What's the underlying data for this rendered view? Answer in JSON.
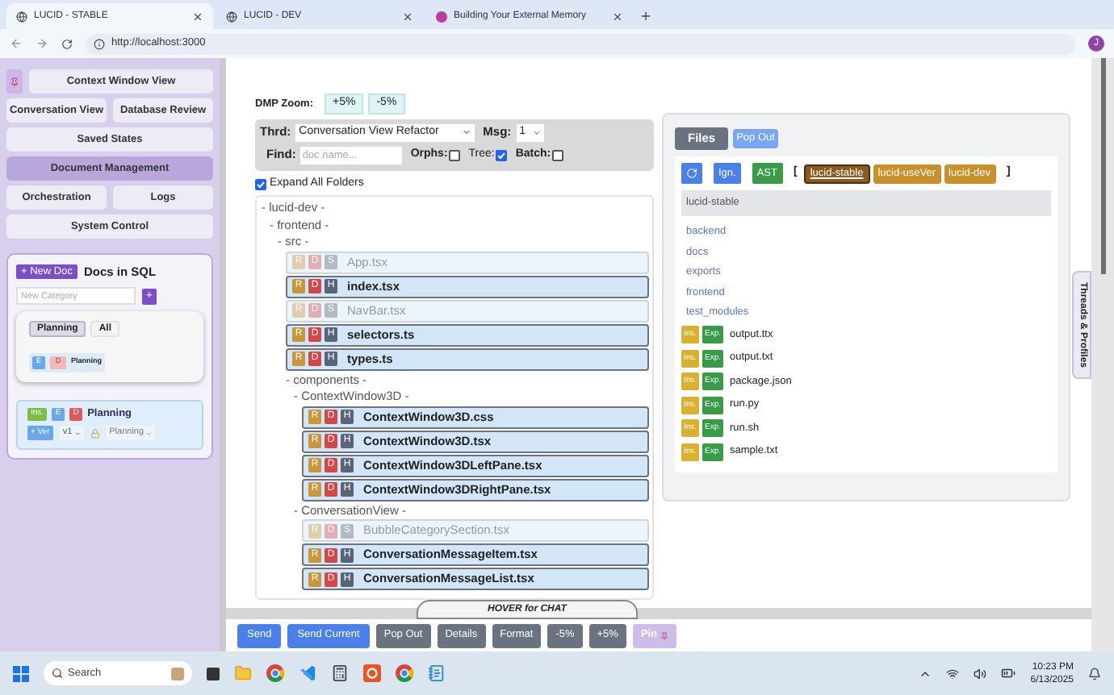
{
  "browser": {
    "tabs": [
      {
        "title": "LUCID - STABLE",
        "selected": true,
        "kind": "globe"
      },
      {
        "title": "LUCID - DEV",
        "selected": false,
        "kind": "globe"
      },
      {
        "title": "Building Your External Memory",
        "selected": false,
        "kind": "dot"
      }
    ],
    "url": "http://localhost:3000",
    "avatar": "J"
  },
  "sidebar": {
    "nav_rows": [
      [
        {
          "label": "Context Window View",
          "selected": false
        }
      ],
      [
        {
          "label": "Conversation View",
          "selected": false
        },
        {
          "label": "Database Review",
          "selected": false
        }
      ],
      [
        {
          "label": "Saved States",
          "selected": false
        }
      ],
      [
        {
          "label": "Document Management",
          "selected": true
        }
      ],
      [
        {
          "label": "Orchestration",
          "selected": false
        },
        {
          "label": "Logs",
          "selected": false
        }
      ],
      [
        {
          "label": "System Control",
          "selected": false
        }
      ]
    ],
    "docs": {
      "new_doc": "+ New Doc",
      "title": "Docs in SQL",
      "category_placeholder": "New Category",
      "add": "+",
      "filters": [
        {
          "label": "Planning",
          "selected": true
        },
        {
          "label": "All",
          "selected": false
        }
      ],
      "chip": {
        "edit": "E",
        "delete": "D",
        "label": "Planning"
      },
      "doc": {
        "ins": "Ins.",
        "edit": "E",
        "delete": "D",
        "title": "Planning",
        "add_version": "+ Ver",
        "version": "v1",
        "category": "Planning"
      }
    }
  },
  "main": {
    "zoom": {
      "label": "DMP Zoom:",
      "buttons": [
        "+5%",
        "-5%"
      ]
    },
    "controls": {
      "thread_label": "Thrd:",
      "thread": "Conversation View Refactor",
      "msg_label": "Msg:",
      "msg": "1",
      "find_label": "Find:",
      "find_placeholder": "doc name...",
      "checks": [
        {
          "label": "Orphs:",
          "checked": false
        },
        {
          "label": "Tree:",
          "checked": true
        },
        {
          "label": "Batch:",
          "checked": false
        }
      ]
    },
    "expand": {
      "label": "Expand All Folders",
      "checked": true
    },
    "tree": [
      {
        "kind": "folder",
        "label": "- lucid-dev -",
        "children": [
          {
            "kind": "folder",
            "label": "- frontend -",
            "children": [
              {
                "kind": "folder",
                "label": "- src -",
                "children": [
                  {
                    "kind": "file",
                    "name": "App.tsx",
                    "badges": [
                      "R",
                      "D",
                      "S"
                    ],
                    "active": false
                  },
                  {
                    "kind": "file",
                    "name": "index.tsx",
                    "badges": [
                      "R",
                      "D",
                      "H"
                    ],
                    "active": true
                  },
                  {
                    "kind": "file",
                    "name": "NavBar.tsx",
                    "badges": [
                      "R",
                      "D",
                      "S"
                    ],
                    "active": false
                  },
                  {
                    "kind": "file",
                    "name": "selectors.ts",
                    "badges": [
                      "R",
                      "D",
                      "H"
                    ],
                    "active": true
                  },
                  {
                    "kind": "file",
                    "name": "types.ts",
                    "badges": [
                      "R",
                      "D",
                      "H"
                    ],
                    "active": true
                  },
                  {
                    "kind": "folder",
                    "label": "- components -",
                    "children": [
                      {
                        "kind": "folder",
                        "label": "- ContextWindow3D -",
                        "children": [
                          {
                            "kind": "file",
                            "name": "ContextWindow3D.css",
                            "badges": [
                              "R",
                              "D",
                              "H"
                            ],
                            "active": true
                          },
                          {
                            "kind": "file",
                            "name": "ContextWindow3D.tsx",
                            "badges": [
                              "R",
                              "D",
                              "H"
                            ],
                            "active": true
                          },
                          {
                            "kind": "file",
                            "name": "ContextWindow3DLeftPane.tsx",
                            "badges": [
                              "R",
                              "D",
                              "H"
                            ],
                            "active": true
                          },
                          {
                            "kind": "file",
                            "name": "ContextWindow3DRightPane.tsx",
                            "badges": [
                              "R",
                              "D",
                              "H"
                            ],
                            "active": true
                          }
                        ]
                      },
                      {
                        "kind": "folder",
                        "label": "- ConversationView -",
                        "children": [
                          {
                            "kind": "file",
                            "name": "BubbleCategorySection.tsx",
                            "badges": [
                              "R",
                              "D",
                              "S"
                            ],
                            "active": false
                          },
                          {
                            "kind": "file",
                            "name": "ConversationMessageItem.tsx",
                            "badges": [
                              "R",
                              "D",
                              "H"
                            ],
                            "active": true
                          },
                          {
                            "kind": "file",
                            "name": "ConversationMessageList.tsx",
                            "badges": [
                              "R",
                              "D",
                              "H"
                            ],
                            "active": true
                          }
                        ]
                      }
                    ]
                  }
                ]
              }
            ]
          }
        ]
      }
    ]
  },
  "files_panel": {
    "tab": "Files",
    "pop_out": "Pop Out",
    "ignore": "Ign.",
    "ast": "AST",
    "open_bracket": "[",
    "close_bracket": "]",
    "repos": [
      {
        "label": "lucid-stable",
        "selected": true
      },
      {
        "label": "lucid-useVer",
        "selected": false
      },
      {
        "label": "lucid-dev",
        "selected": false
      }
    ],
    "path": "lucid-stable",
    "folders": [
      "backend",
      "docs",
      "exports",
      "frontend",
      "test_modules"
    ],
    "files": [
      {
        "name": "output.ttx",
        "import": "Ins.",
        "export": "Exp."
      },
      {
        "name": "output.txt",
        "import": "Ins.",
        "export": "Exp."
      },
      {
        "name": "package.json",
        "import": "Ins.",
        "export": "Exp."
      },
      {
        "name": "run.py",
        "import": "Ins.",
        "export": "Exp."
      },
      {
        "name": "run.sh",
        "import": "Ins.",
        "export": "Exp."
      },
      {
        "name": "sample.txt",
        "import": "Ins.",
        "export": "Exp."
      }
    ]
  },
  "side_tab": "Threads & Profiles",
  "chat_handle": "HOVER for CHAT",
  "actions": [
    {
      "label": "Send",
      "kind": "primary"
    },
    {
      "label": "Send Current",
      "kind": "primary"
    },
    {
      "label": "Pop Out",
      "kind": "secondary"
    },
    {
      "label": "Details",
      "kind": "secondary"
    },
    {
      "label": "Format",
      "kind": "secondary"
    },
    {
      "label": "-5%",
      "kind": "secondary"
    },
    {
      "label": "+5%",
      "kind": "secondary"
    },
    {
      "label": "Pin",
      "kind": "pin"
    }
  ],
  "taskbar": {
    "search_placeholder": "Search",
    "time": "10:23 PM",
    "date": "6/13/2025"
  }
}
